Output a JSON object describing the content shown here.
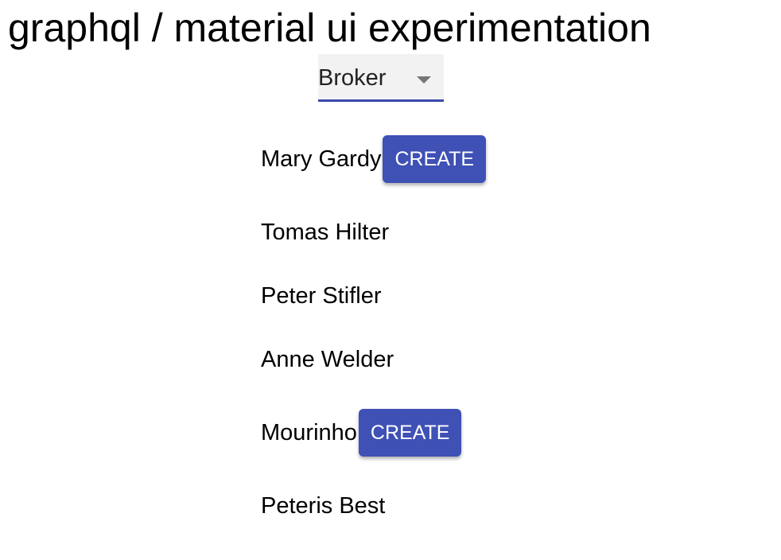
{
  "title": "graphql / material ui experimentation",
  "select": {
    "value": "Broker"
  },
  "items": [
    {
      "name": "Mary Gardy",
      "button": "CREATE"
    },
    {
      "name": "Tomas Hilter"
    },
    {
      "name": "Peter Stifler"
    },
    {
      "name": "Anne Welder"
    },
    {
      "name": "Mourinho",
      "button": "CREATE"
    },
    {
      "name": "Peteris Best"
    }
  ]
}
